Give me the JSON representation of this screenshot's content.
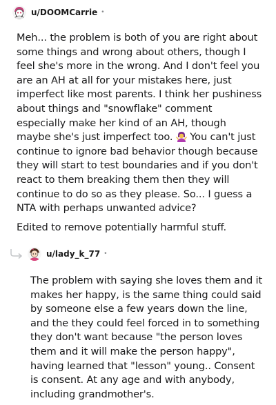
{
  "comment1": {
    "username": "u/DOOMCarrie",
    "separator": "•",
    "paragraph1_before_emoji": "Meh... the problem is both of you are right about some things and wrong about others, though I feel she's more in the wrong. And I don't feel you are an AH at all for your mistakes here, just imperfect like most parents. I think her pushiness about things and \"snowflake\" comment especially make her kind of an AH, though maybe she's just imperfect too.",
    "paragraph1_after_emoji": "You can't just continue to ignore bad behavior though because they will start to test boundaries and if you don't react to them breaking them then they will continue to do so as they please. So... I guess a NTA with perhaps unwanted advice?",
    "paragraph2": "Edited to remove potentially harmful stuff.",
    "inline_emoji": "woman-shrugging-emoji-icon"
  },
  "comment2": {
    "username": "u/lady_k_77",
    "separator": "•",
    "paragraph1": "The problem with saying she loves them and it makes her happy, is the same thing could said by someone else a few years down the line, and the they could feel forced in to something they don't want because \"the person loves them and it will make the person happy\", having learned that \"lesson\" young.. Consent is consent. At any age and with anybody, including grandmother's."
  },
  "colors": {
    "text": "#1a1a1b",
    "meta": "#878a8c",
    "reply_line": "#c4c6c8"
  }
}
